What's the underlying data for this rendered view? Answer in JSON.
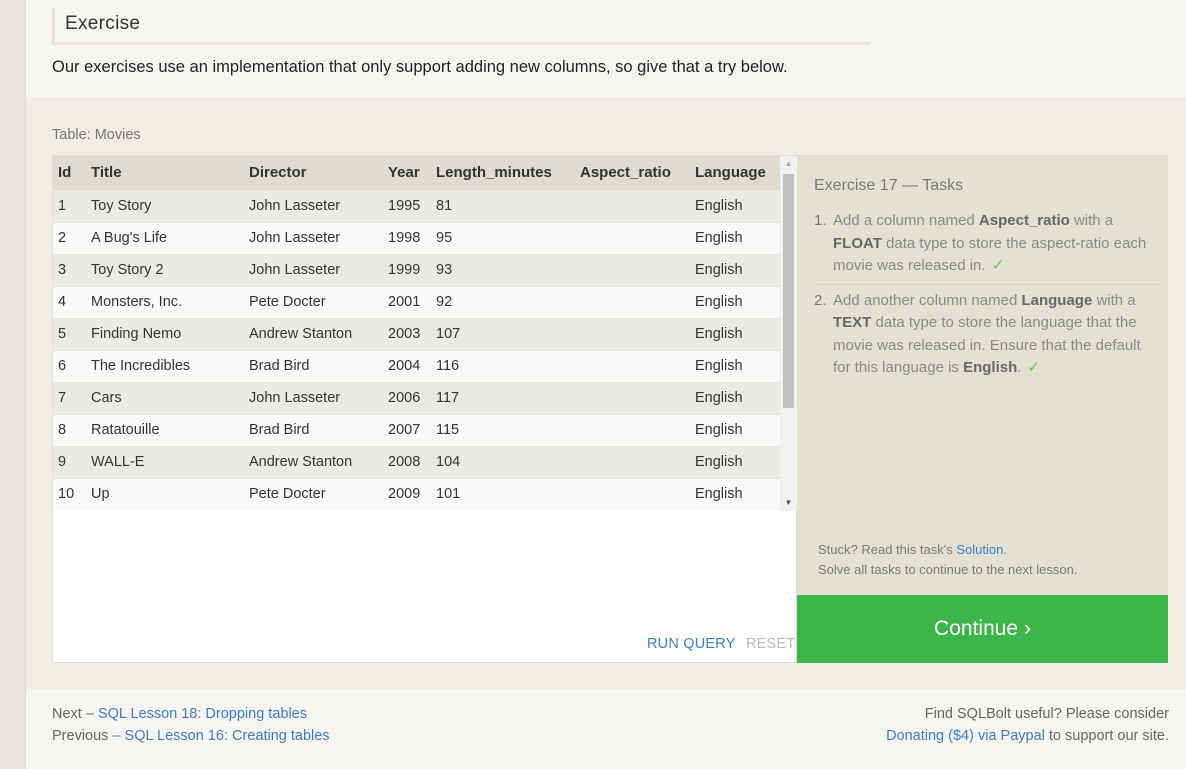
{
  "exercise": {
    "heading": "Exercise",
    "intro": "Our exercises use an implementation that only support adding new columns, so give that a try below."
  },
  "table": {
    "label": "Table: Movies",
    "columns": [
      "Id",
      "Title",
      "Director",
      "Year",
      "Length_minutes",
      "Aspect_ratio",
      "Language"
    ],
    "rows": [
      [
        "1",
        "Toy Story",
        "John Lasseter",
        "1995",
        "81",
        "",
        "English"
      ],
      [
        "2",
        "A Bug's Life",
        "John Lasseter",
        "1998",
        "95",
        "",
        "English"
      ],
      [
        "3",
        "Toy Story 2",
        "John Lasseter",
        "1999",
        "93",
        "",
        "English"
      ],
      [
        "4",
        "Monsters, Inc.",
        "Pete Docter",
        "2001",
        "92",
        "",
        "English"
      ],
      [
        "5",
        "Finding Nemo",
        "Andrew Stanton",
        "2003",
        "107",
        "",
        "English"
      ],
      [
        "6",
        "The Incredibles",
        "Brad Bird",
        "2004",
        "116",
        "",
        "English"
      ],
      [
        "7",
        "Cars",
        "John Lasseter",
        "2006",
        "117",
        "",
        "English"
      ],
      [
        "8",
        "Ratatouille",
        "Brad Bird",
        "2007",
        "115",
        "",
        "English"
      ],
      [
        "9",
        "WALL-E",
        "Andrew Stanton",
        "2008",
        "104",
        "",
        "English"
      ],
      [
        "10",
        "Up",
        "Pete Docter",
        "2009",
        "101",
        "",
        "English"
      ]
    ]
  },
  "actions": {
    "run_query": "RUN QUERY",
    "reset": "RESET"
  },
  "tasks": {
    "title": "Exercise 17 — Tasks",
    "items": [
      {
        "num": "1.",
        "parts": [
          "Add a column named ",
          "Aspect_ratio",
          " with a ",
          "FLOAT",
          " data type to store the aspect-ratio each movie was released in."
        ],
        "check": "✓"
      },
      {
        "num": "2.",
        "parts": [
          "Add another column named ",
          "Language",
          " with a ",
          "TEXT",
          " data type to store the language that the movie was released in. Ensure that the default for this language is ",
          "English",
          "."
        ],
        "check": "✓"
      }
    ],
    "stuck_prefix": "Stuck? Read this task's ",
    "solution_link": "Solution",
    "stuck_suffix": ".",
    "next_note": "Solve all tasks to continue to the next lesson.",
    "continue_label": "Continue ›"
  },
  "footer": {
    "next_prefix": "Next – ",
    "next_link": "SQL Lesson 18: Dropping tables",
    "prev_prefix": "Previous – ",
    "prev_link": "SQL Lesson 16: Creating tables",
    "support_line1": "Find SQLBolt useful? Please consider",
    "support_link": "Donating ($4) via Paypal",
    "support_suffix": " to support our site."
  },
  "colors": {
    "accent_green": "#3cb54a",
    "link_blue": "#3c7cc6",
    "check_green": "#6fbf5a"
  }
}
